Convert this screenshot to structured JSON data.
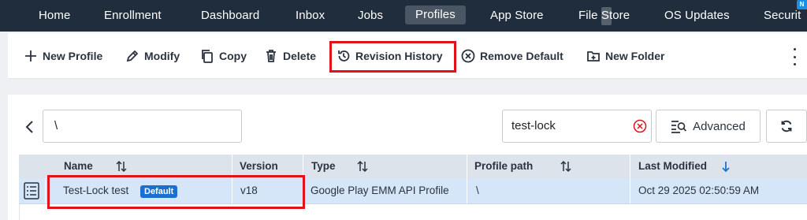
{
  "nav": {
    "items": [
      {
        "label": "Home",
        "active": false
      },
      {
        "label": "Enrollment",
        "active": false
      },
      {
        "label": "Dashboard",
        "active": false
      },
      {
        "label": "Inbox",
        "active": false
      },
      {
        "label": "Jobs",
        "active": false
      },
      {
        "label": "Profiles",
        "active": true
      },
      {
        "label": "App Store",
        "active": false
      },
      {
        "label": "File Store",
        "active": false
      },
      {
        "label": "OS Updates",
        "active": false
      },
      {
        "label": "Securit",
        "active": false
      }
    ],
    "badge": "N"
  },
  "toolbar": {
    "new_profile": "New Profile",
    "modify": "Modify",
    "copy": "Copy",
    "delete": "Delete",
    "revision_history": "Revision History",
    "remove_default": "Remove Default",
    "new_folder": "New Folder"
  },
  "filter": {
    "path_value": "\\",
    "search_value": "test-lock",
    "advanced_label": "Advanced"
  },
  "table": {
    "columns": {
      "name": "Name",
      "version": "Version",
      "type": "Type",
      "profile_path": "Profile path",
      "last_modified": "Last Modified"
    },
    "sort_column": "Last Modified",
    "sort_direction": "descending",
    "rows": [
      {
        "name": "Test-Lock test",
        "badge": "Default",
        "version": "v18",
        "type": "Google Play EMM API Profile",
        "profile_path": "\\",
        "last_modified": "Oct 29 2025 02:50:59 AM"
      }
    ]
  },
  "colors": {
    "nav_bg": "#1f2d3d",
    "highlight": "#e2121b",
    "selected_row": "#d4e6f7",
    "badge": "#1b6fd1",
    "header_bg": "#dce3ea"
  }
}
